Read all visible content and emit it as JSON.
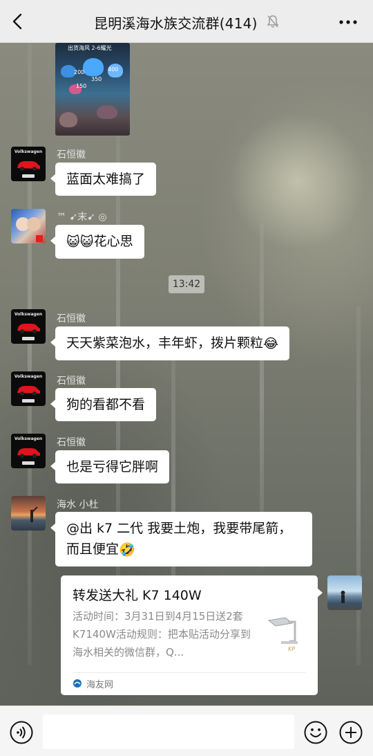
{
  "header": {
    "title": "昆明溪海水族交流群(414)",
    "back_icon": "chevron-left-icon",
    "mute_icon": "bell-muted-icon",
    "more_icon": "ellipsis-icon"
  },
  "image_message": {
    "caption": "出货海风 2-6耀光",
    "labels": [
      "200",
      "400",
      "350",
      "150"
    ]
  },
  "messages": [
    {
      "sender": "石恒徽",
      "avatar": "car-avatar",
      "text": "蓝面太难搞了"
    },
    {
      "sender": "™ ➹末➹ ◎",
      "avatar": "anime-avatar",
      "emoji": "😺😺",
      "text": "花心思"
    },
    {
      "sender": "石恒徽",
      "avatar": "car-avatar",
      "text": "天天紫菜泡水，丰年虾，拨片颗粒",
      "emoji_end": "😂"
    },
    {
      "sender": "石恒徽",
      "avatar": "car-avatar",
      "text": "狗的看都不看"
    },
    {
      "sender": "石恒徽",
      "avatar": "car-avatar",
      "text": "也是亏得它胖啊"
    },
    {
      "sender": "海水 小杜",
      "avatar": "sunset-avatar",
      "line1": "@出 k7 二代  我要土炮，我要带尾箭，",
      "line2": "而且便宜",
      "emoji_end": "🤣"
    }
  ],
  "timestamp": "13:42",
  "avatar_brand": "Volkswagen",
  "link_card": {
    "title": "转发送大礼 K7 140W",
    "description": "活动时间：3月31日到4月15日送2套K7140W活动规则：把本贴活动分享到海水相关的微信群，Q...",
    "source": "海友网"
  },
  "input": {
    "placeholder": "",
    "value": ""
  },
  "colors": {
    "header_bg": "#ededed",
    "bubble_bg": "#ffffff",
    "input_bar_bg": "#f5f5f5"
  }
}
